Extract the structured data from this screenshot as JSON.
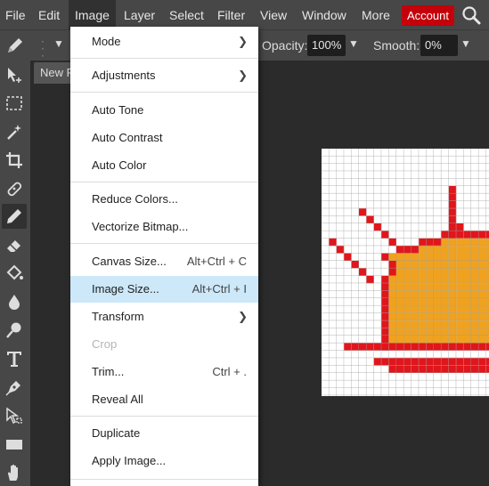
{
  "menubar": {
    "items": [
      "File",
      "Edit",
      "Image",
      "Layer",
      "Select",
      "Filter",
      "View",
      "Window",
      "More"
    ],
    "account_label": "Account"
  },
  "options": {
    "opacity_label": "Opacity:",
    "opacity_value": "100%",
    "smooth_label": "Smooth:",
    "smooth_value": "0%"
  },
  "document": {
    "tab_title": "New P"
  },
  "image_menu": {
    "mode": "Mode",
    "adjustments": "Adjustments",
    "auto_tone": "Auto Tone",
    "auto_contrast": "Auto Contrast",
    "auto_color": "Auto Color",
    "reduce_colors": "Reduce Colors...",
    "vectorize_bitmap": "Vectorize Bitmap...",
    "canvas_size": "Canvas Size...",
    "canvas_size_shortcut": "Alt+Ctrl + C",
    "image_size": "Image Size...",
    "image_size_shortcut": "Alt+Ctrl + I",
    "transform": "Transform",
    "crop": "Crop",
    "trim": "Trim...",
    "trim_shortcut": "Ctrl + .",
    "reveal_all": "Reveal All",
    "duplicate": "Duplicate",
    "apply_image": "Apply Image..."
  },
  "colors": {
    "accent": "#c4000b",
    "hover": "#cce8f9",
    "pixel_red": "#e0161c",
    "pixel_orange": "#f0a21e"
  },
  "icons": [
    "search-icon",
    "brush-icon",
    "move-icon",
    "marquee-icon",
    "magic-wand-icon",
    "crop-icon",
    "healing-icon",
    "pencil-icon",
    "eraser-icon",
    "bucket-icon",
    "blur-icon",
    "dodge-icon",
    "type-icon",
    "pen-icon",
    "select-arrow-icon",
    "rectangle-icon",
    "hand-icon"
  ]
}
